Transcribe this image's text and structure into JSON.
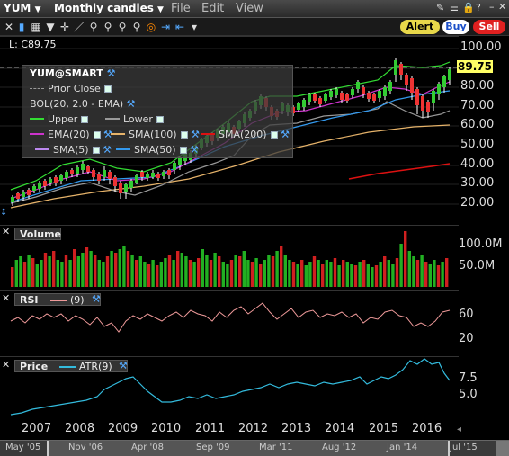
{
  "window": {
    "symbol": "YUM",
    "period": "Monthly candles",
    "menus": [
      "File",
      "Edit",
      "View"
    ]
  },
  "toolbar": {
    "alert": "Alert",
    "buy": "Buy",
    "sell": "Sell"
  },
  "price_panel": {
    "last": "L: C89.75",
    "current_price": "89.75",
    "yticks": [
      "100.00",
      "90.00",
      "80.00",
      "70.00",
      "60.00",
      "50.00",
      "40.00",
      "30.00",
      "20.00"
    ],
    "legend": {
      "title": "YUM@SMART",
      "prior_close": "Prior Close",
      "bol": "BOL(20, 2.0 - EMA)",
      "upper": "Upper",
      "lower": "Lower",
      "ema20": "EMA(20)",
      "sma100": "SMA(100)",
      "sma200": "SMA(200)",
      "sma5": "SMA(5)",
      "sma50": "SMA(50)"
    },
    "colors": {
      "upper": "#33dd33",
      "lower": "#999999",
      "ema20": "#cc33cc",
      "sma100": "#e6b36a",
      "sma200": "#dd1111",
      "sma5": "#bb88ee",
      "sma50": "#3399ee"
    }
  },
  "volume_panel": {
    "label": "Volume",
    "yticks": [
      "100.0M",
      "50.0M"
    ]
  },
  "rsi_panel": {
    "label": "RSI",
    "param": "(9)",
    "yticks": [
      "60",
      "20"
    ]
  },
  "atr_panel": {
    "label": "Price",
    "series": "ATR(9)",
    "yticks": [
      "7.5",
      "5.0"
    ]
  },
  "xaxis": {
    "years": [
      "2007",
      "2008",
      "2009",
      "2010",
      "2011",
      "2012",
      "2013",
      "2014",
      "2015",
      "2016"
    ]
  },
  "navigator": {
    "labels": [
      "May '05",
      "Nov '06",
      "Apr '08",
      "Sep '09",
      "Mar '11",
      "Aug '12",
      "Jan '14",
      "Jul '15"
    ]
  }
}
